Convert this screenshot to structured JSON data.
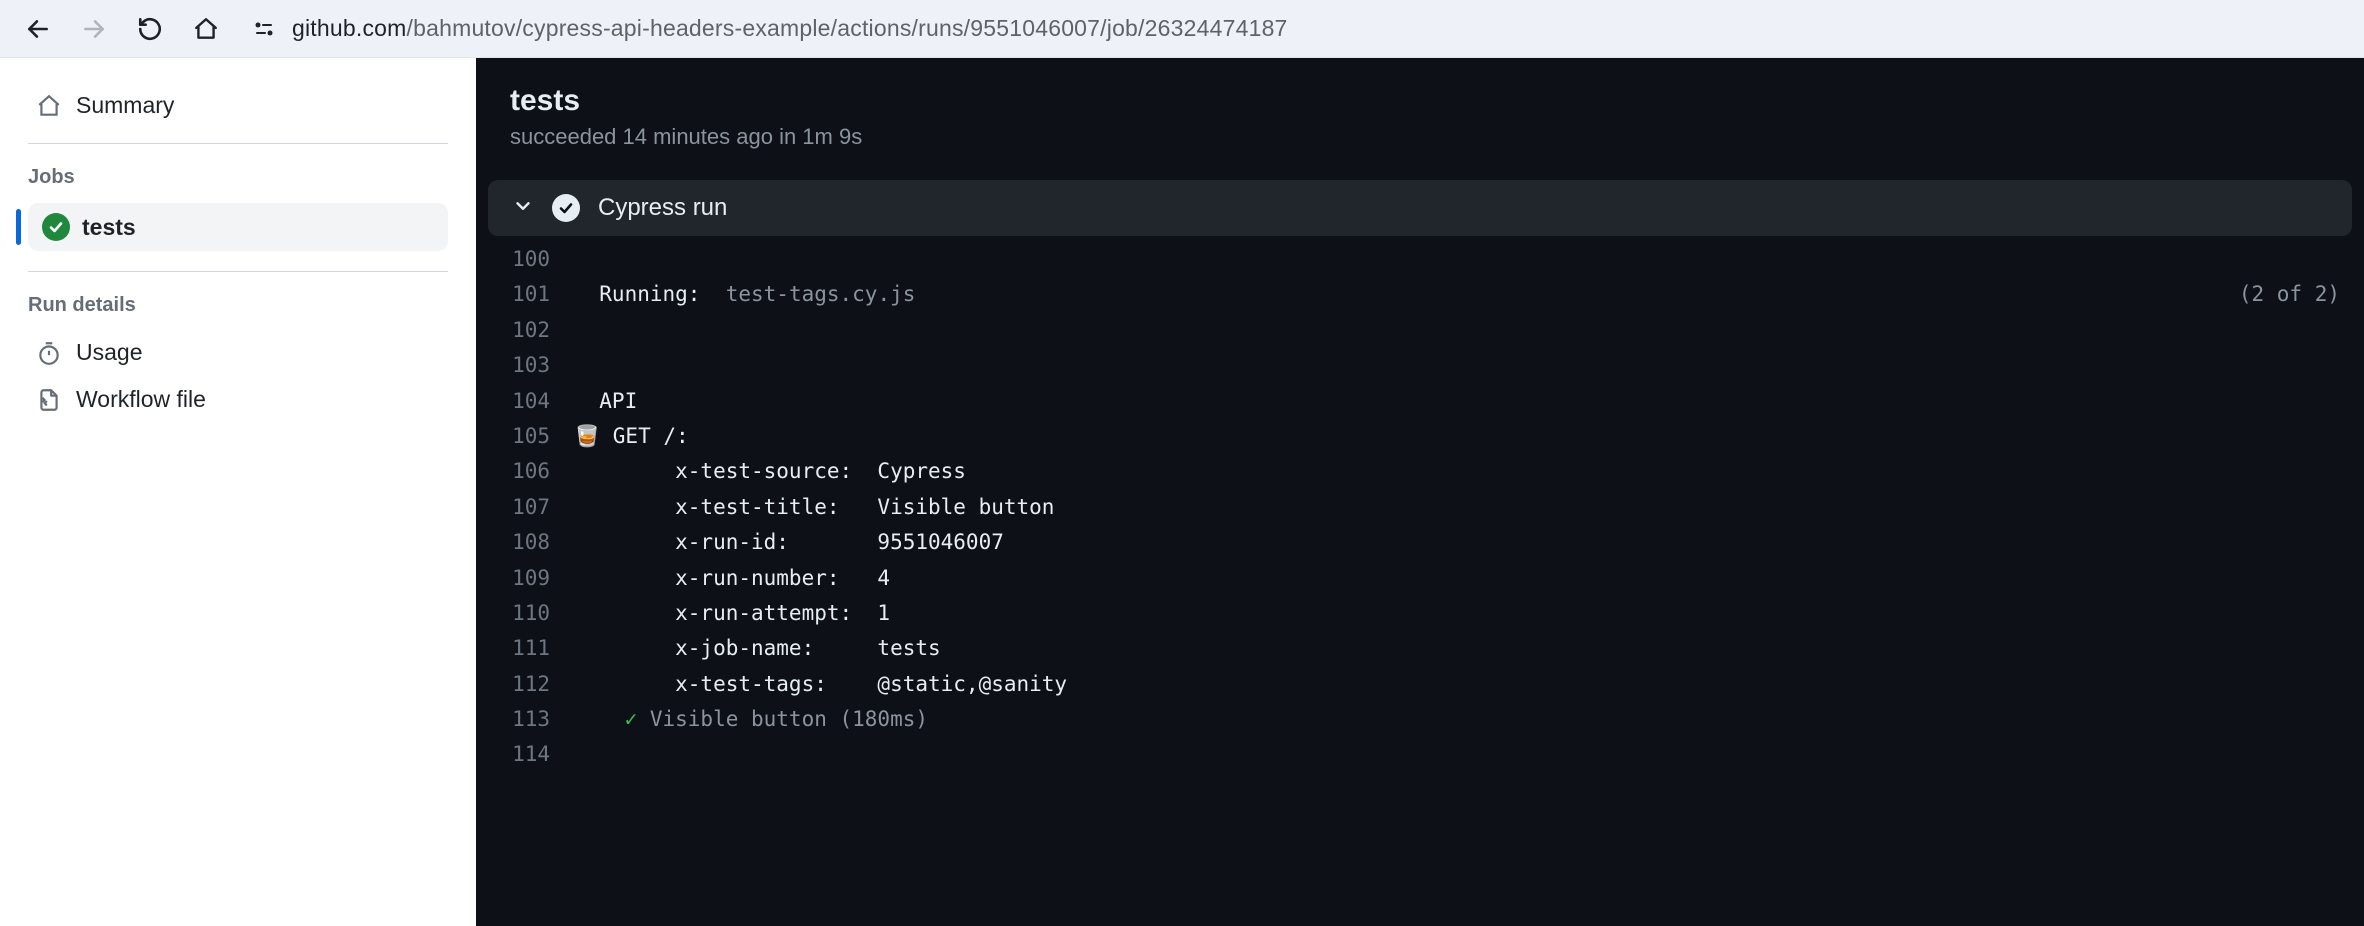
{
  "url": {
    "domain": "github.com",
    "path": "/bahmutov/cypress-api-headers-example/actions/runs/9551046007/job/26324474187"
  },
  "sidebar": {
    "summary_label": "Summary",
    "jobs_label": "Jobs",
    "job_name": "tests",
    "run_details_label": "Run details",
    "usage_label": "Usage",
    "workflow_file_label": "Workflow file"
  },
  "main": {
    "title": "tests",
    "subtitle": "succeeded 14 minutes ago in 1m 9s",
    "step_title": "Cypress run"
  },
  "log": {
    "lines": [
      {
        "n": "100",
        "content": ""
      },
      {
        "n": "101",
        "content_bright": "  Running:",
        "content_dim": "  test-tags.cy.js",
        "right": "(2 of 2)"
      },
      {
        "n": "102",
        "content": ""
      },
      {
        "n": "103",
        "content": ""
      },
      {
        "n": "104",
        "content": "  API"
      },
      {
        "n": "105",
        "content": "🥃 GET /:"
      },
      {
        "n": "106",
        "content": "        x-test-source:  Cypress"
      },
      {
        "n": "107",
        "content": "        x-test-title:   Visible button"
      },
      {
        "n": "108",
        "content": "        x-run-id:       9551046007"
      },
      {
        "n": "109",
        "content": "        x-run-number:   4"
      },
      {
        "n": "110",
        "content": "        x-run-attempt:  1"
      },
      {
        "n": "111",
        "content": "        x-job-name:     tests"
      },
      {
        "n": "112",
        "content": "        x-test-tags:    @static,@sanity"
      },
      {
        "n": "113",
        "check": "    ✓ ",
        "dim_after": "Visible button (180ms)"
      },
      {
        "n": "114",
        "content": ""
      }
    ]
  }
}
